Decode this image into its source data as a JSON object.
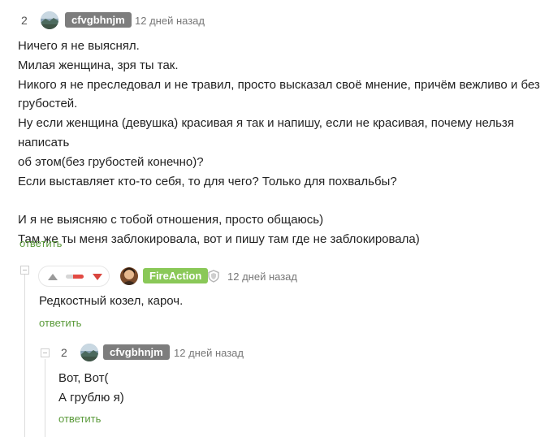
{
  "comment1": {
    "rating": "2",
    "username": "cfvgbhnjm",
    "time": "12 дней назад",
    "lines": [
      "Ничего я не выяснял.",
      "Милая женщина, зря ты так.",
      "Никого я не преследовал и не травил, просто высказал своё мнение, причём вежливо и без",
      "грубостей.",
      "Ну если женщина (девушка) красивая я так и напишу, если не красивая, почему нельзя написать",
      "об этом(без грубостей конечно)?",
      "Если выставляет кто-то себя, то для чего? Только для похвальбы?",
      "",
      "И я не выясняю с тобой отношения, просто общаюсь)",
      "Там же ты меня заблокировала, вот и пишу там где не заблокировала)"
    ],
    "reply_label": "ответить"
  },
  "comment2": {
    "username": "FireAction",
    "time": "12 дней назад",
    "vote_negative_share": 0.6,
    "lines": [
      "Редкостный козел, кароч."
    ],
    "reply_label": "ответить"
  },
  "comment3": {
    "rating": "2",
    "username": "cfvgbhnjm",
    "time": "12 дней назад",
    "lines": [
      "Вот, Вот(",
      "А грублю я)"
    ],
    "reply_label": "ответить"
  },
  "colors": {
    "reply_link": "#5a9a3a",
    "badge_gray": "#7d7d7d",
    "badge_green": "#8ac858",
    "downvote": "#d9453e"
  },
  "icons": [
    "avatar-landscape",
    "avatar-portrait",
    "shield-icon",
    "collapse-icon",
    "upvote-icon",
    "downvote-icon"
  ]
}
